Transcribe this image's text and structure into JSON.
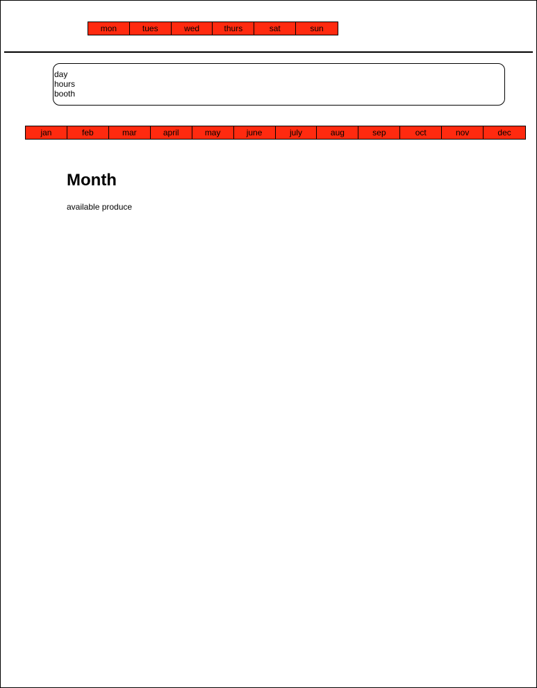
{
  "days": [
    "mon",
    "tues",
    "wed",
    "thurs",
    "sat",
    "sun"
  ],
  "info": {
    "day_label": "day",
    "hours_label": "hours",
    "booth_label": "booth"
  },
  "months": [
    "jan",
    "feb",
    "mar",
    "april",
    "may",
    "june",
    "july",
    "aug",
    "sep",
    "oct",
    "nov",
    "dec"
  ],
  "main": {
    "title": "Month",
    "produce_label": "available produce"
  },
  "colors": {
    "tab_background": "#ff2a0f",
    "border": "#000000"
  }
}
